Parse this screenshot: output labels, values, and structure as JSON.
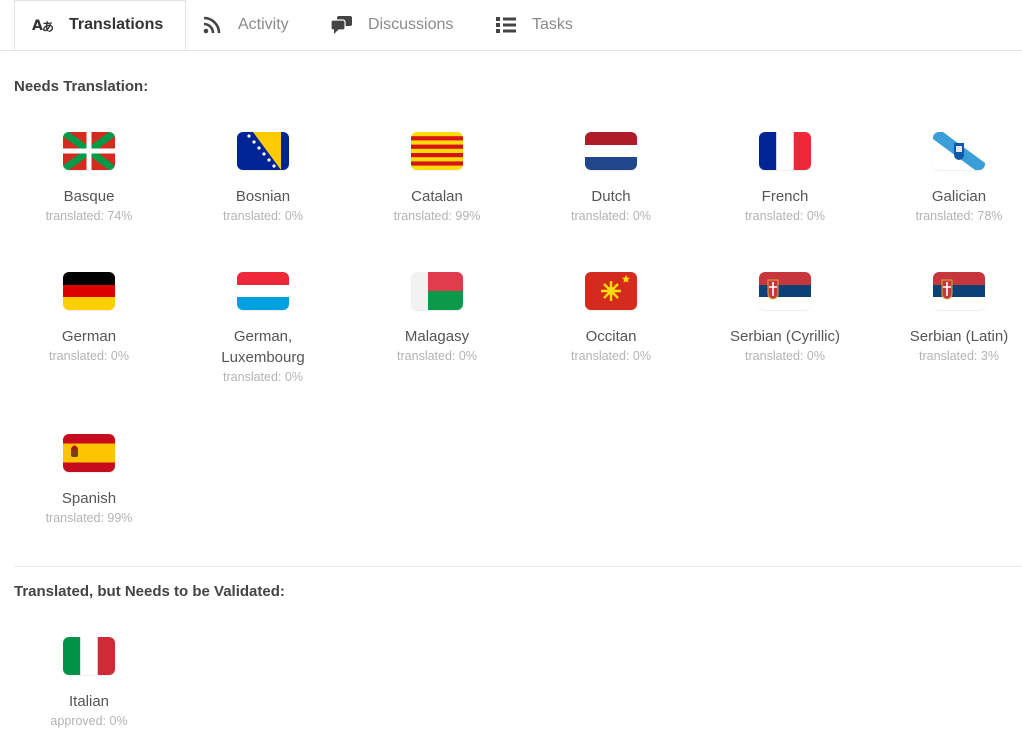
{
  "tabs": [
    {
      "label": "Translations",
      "icon": "translate-icon",
      "active": true
    },
    {
      "label": "Activity",
      "icon": "rss-icon",
      "active": false
    },
    {
      "label": "Discussions",
      "icon": "comments-icon",
      "active": false
    },
    {
      "label": "Tasks",
      "icon": "list-icon",
      "active": false
    }
  ],
  "needs_translation": {
    "title": "Needs Translation:",
    "languages": [
      {
        "name": "Basque",
        "status": "translated: 74%",
        "flag": "basque-flag-icon"
      },
      {
        "name": "Bosnian",
        "status": "translated: 0%",
        "flag": "bosnia-flag-icon"
      },
      {
        "name": "Catalan",
        "status": "translated: 99%",
        "flag": "catalan-flag-icon"
      },
      {
        "name": "Dutch",
        "status": "translated: 0%",
        "flag": "netherlands-flag-icon"
      },
      {
        "name": "French",
        "status": "translated: 0%",
        "flag": "france-flag-icon"
      },
      {
        "name": "Galician",
        "status": "translated: 78%",
        "flag": "galicia-flag-icon"
      },
      {
        "name": "German",
        "status": "translated: 0%",
        "flag": "germany-flag-icon"
      },
      {
        "name": "German, Luxembourg",
        "status": "translated: 0%",
        "flag": "luxembourg-flag-icon"
      },
      {
        "name": "Malagasy",
        "status": "translated: 0%",
        "flag": "madagascar-flag-icon"
      },
      {
        "name": "Occitan",
        "status": "translated: 0%",
        "flag": "occitan-flag-icon"
      },
      {
        "name": "Serbian (Cyrillic)",
        "status": "translated: 0%",
        "flag": "serbia-flag-icon"
      },
      {
        "name": "Serbian (Latin)",
        "status": "translated: 3%",
        "flag": "serbia-flag-icon"
      },
      {
        "name": "Spanish",
        "status": "translated: 99%",
        "flag": "spain-flag-icon"
      }
    ]
  },
  "needs_validation": {
    "title": "Translated, but Needs to be Validated:",
    "languages": [
      {
        "name": "Italian",
        "status": "approved: 0%",
        "flag": "italy-flag-icon"
      }
    ]
  },
  "colors": {
    "active_tab_text": "#333333",
    "inactive_tab_text": "#8a8a8a",
    "status_text": "#b3b3b3"
  }
}
